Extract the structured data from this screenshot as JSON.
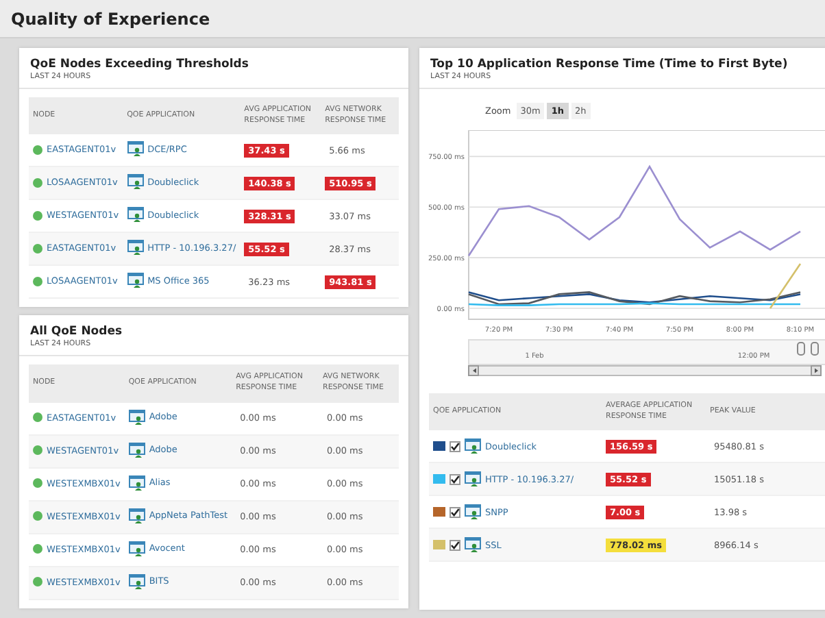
{
  "page_title": "Quality of Experience",
  "exceeding": {
    "title": "QoE Nodes Exceeding Thresholds",
    "subtitle": "LAST 24 HOURS",
    "columns": [
      "NODE",
      "QOE APPLICATION",
      "AVG APPLICATION RESPONSE TIME",
      "AVG NETWORK RESPONSE TIME"
    ],
    "rows": [
      {
        "node": "EASTAGENT01v",
        "application": "DCE/RPC",
        "app_time": {
          "value": "37.43 s",
          "kind": "critical"
        },
        "net_time": {
          "value": "5.66 ms",
          "kind": "normal"
        }
      },
      {
        "node": "LOSAAGENT01v",
        "application": "Doubleclick",
        "app_time": {
          "value": "140.38 s",
          "kind": "critical"
        },
        "net_time": {
          "value": "510.95 s",
          "kind": "critical"
        }
      },
      {
        "node": "WESTAGENT01v",
        "application": "Doubleclick",
        "app_time": {
          "value": "328.31 s",
          "kind": "critical"
        },
        "net_time": {
          "value": "33.07 ms",
          "kind": "normal"
        }
      },
      {
        "node": "EASTAGENT01v",
        "application": "HTTP - 10.196.3.27/",
        "app_time": {
          "value": "55.52 s",
          "kind": "critical"
        },
        "net_time": {
          "value": "28.37 ms",
          "kind": "normal"
        }
      },
      {
        "node": "LOSAAGENT01v",
        "application": "MS Office 365",
        "app_time": {
          "value": "36.23 ms",
          "kind": "normal"
        },
        "net_time": {
          "value": "943.81 s",
          "kind": "critical"
        }
      }
    ]
  },
  "all_nodes": {
    "title": "All QoE Nodes",
    "subtitle": "LAST 24 HOURS",
    "columns": [
      "NODE",
      "QOE APPLICATION",
      "AVG APPLICATION RESPONSE TIME",
      "AVG NETWORK RESPONSE TIME"
    ],
    "rows": [
      {
        "node": "EASTAGENT01v",
        "application": "Adobe",
        "app_time": "0.00 ms",
        "net_time": "0.00 ms"
      },
      {
        "node": "WESTAGENT01v",
        "application": "Adobe",
        "app_time": "0.00 ms",
        "net_time": "0.00 ms"
      },
      {
        "node": "WESTEXMBX01v",
        "application": "Alias",
        "app_time": "0.00 ms",
        "net_time": "0.00 ms"
      },
      {
        "node": "WESTEXMBX01v",
        "application": "AppNeta PathTest",
        "app_time": "0.00 ms",
        "net_time": "0.00 ms"
      },
      {
        "node": "WESTEXMBX01v",
        "application": "Avocent",
        "app_time": "0.00 ms",
        "net_time": "0.00 ms"
      },
      {
        "node": "WESTEXMBX01v",
        "application": "BITS",
        "app_time": "0.00 ms",
        "net_time": "0.00 ms"
      }
    ]
  },
  "top10": {
    "title": "Top 10 Application Response Time (Time to First Byte)",
    "subtitle": "LAST 24 HOURS",
    "zoom": {
      "label": "Zoom",
      "options": [
        {
          "label": "30m",
          "selected": false
        },
        {
          "label": "1h",
          "selected": true
        },
        {
          "label": "2h",
          "selected": false
        }
      ]
    },
    "chart_data": {
      "type": "line",
      "grid": true,
      "ylim": [
        0,
        880
      ],
      "categories": [
        null,
        "7:20 PM",
        null,
        "7:30 PM",
        null,
        "7:40 PM",
        null,
        "7:50 PM",
        null,
        "8:00 PM",
        null,
        "8:10 PM"
      ],
      "yticks": [
        {
          "value": 0,
          "label": "0.00 ms"
        },
        {
          "value": 250,
          "label": "250.00 ms"
        },
        {
          "value": 500,
          "label": "500.00 ms"
        },
        {
          "value": 750,
          "label": "750.00 ms"
        }
      ],
      "series": [
        {
          "color": "#9b8fd0",
          "values": [
            260,
            490,
            505,
            450,
            340,
            450,
            700,
            440,
            300,
            380,
            290,
            380
          ]
        },
        {
          "color": "#1f4e8c",
          "values": [
            80,
            40,
            50,
            60,
            70,
            40,
            30,
            45,
            60,
            50,
            40,
            70
          ]
        },
        {
          "color": "#555a60",
          "values": [
            70,
            20,
            25,
            70,
            80,
            35,
            20,
            60,
            35,
            30,
            45,
            80
          ]
        },
        {
          "color": "#33bbee",
          "values": [
            20,
            15,
            15,
            20,
            20,
            20,
            25,
            20,
            20,
            20,
            20,
            20
          ]
        },
        {
          "color": "#d4c06a",
          "values": [
            null,
            null,
            null,
            null,
            null,
            null,
            null,
            null,
            null,
            null,
            0,
            220
          ]
        }
      ]
    },
    "navigator": {
      "labels": [
        "1 Feb",
        "12:00 PM"
      ]
    },
    "legend": {
      "columns": [
        "QOE APPLICATION",
        "AVERAGE APPLICATION RESPONSE TIME",
        "PEAK VALUE"
      ],
      "rows": [
        {
          "color": "#1f4e8c",
          "checked": true,
          "application": "Doubleclick",
          "avg": {
            "value": "156.59 s",
            "kind": "critical"
          },
          "peak": "95480.81 s"
        },
        {
          "color": "#33bbee",
          "checked": true,
          "application": "HTTP - 10.196.3.27/",
          "avg": {
            "value": "55.52 s",
            "kind": "critical"
          },
          "peak": "15051.18 s"
        },
        {
          "color": "#b5652a",
          "checked": true,
          "application": "SNPP",
          "avg": {
            "value": "7.00 s",
            "kind": "critical"
          },
          "peak": "13.98 s"
        },
        {
          "color": "#d4c06a",
          "checked": true,
          "application": "SSL",
          "avg": {
            "value": "778.02 ms",
            "kind": "warning"
          },
          "peak": "8966.14 s"
        }
      ]
    }
  }
}
